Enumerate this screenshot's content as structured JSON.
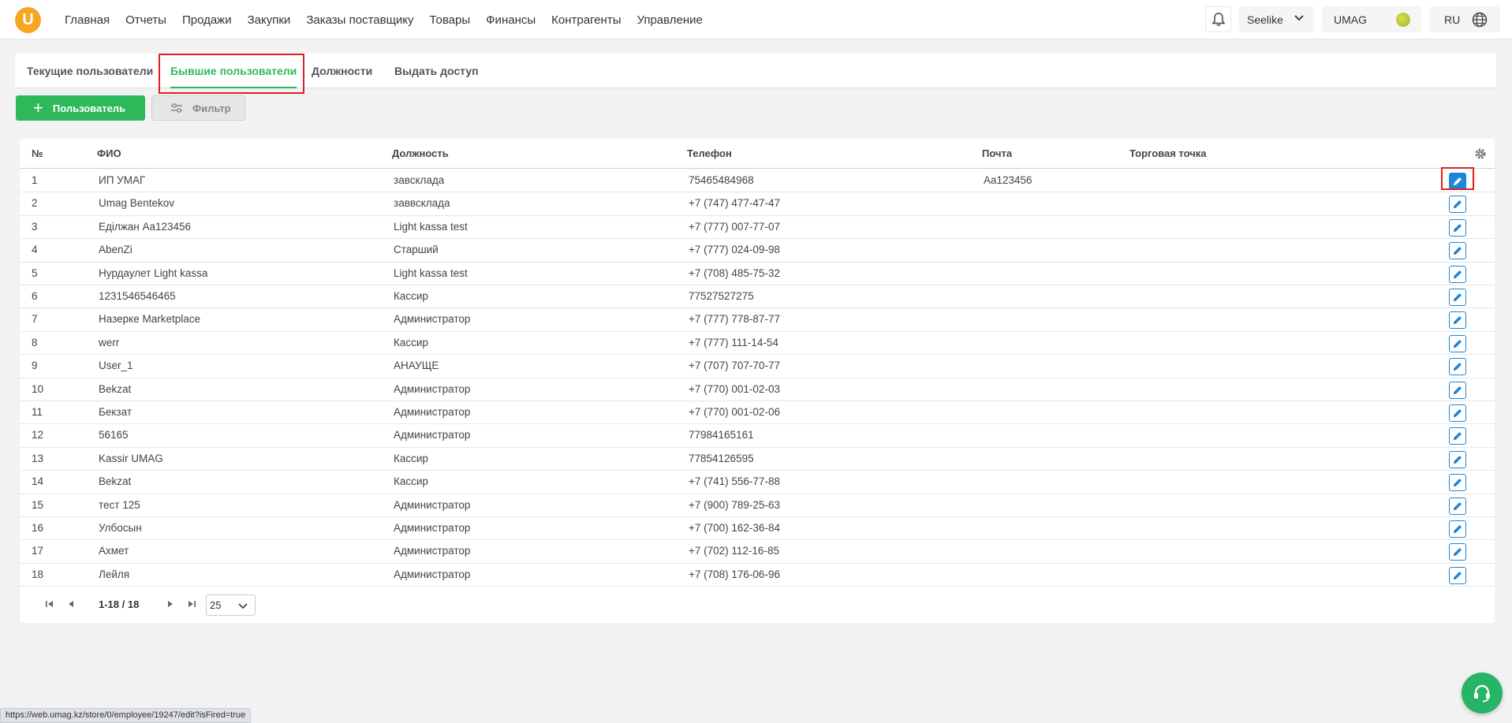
{
  "nav": {
    "logo": "U",
    "items": [
      "Главная",
      "Отчеты",
      "Продажи",
      "Закупки",
      "Заказы поставщику",
      "Товары",
      "Финансы",
      "Контрагенты",
      "Управление"
    ]
  },
  "header": {
    "store": "Seelike",
    "user": "UMAG",
    "lang": "RU"
  },
  "tabs": [
    "Текущие пользователи",
    "Бывшие пользователи",
    "Должности",
    "Выдать доступ"
  ],
  "toolbar": {
    "add_label": "Пользователь",
    "filter_label": "Фильтр"
  },
  "table": {
    "headers": [
      "№",
      "ФИО",
      "Должность",
      "Телефон",
      "Почта",
      "Торговая точка"
    ],
    "rows": [
      [
        "1",
        "ИП УМАГ",
        "завсклада",
        "75465484968",
        "Aa123456",
        ""
      ],
      [
        "2",
        "Umag Bentekov",
        "заввсклада",
        "+7 (747) 477-47-47",
        "",
        ""
      ],
      [
        "3",
        "Еділжан Aa123456",
        "Light kassa test",
        "+7 (777) 007-77-07",
        "",
        ""
      ],
      [
        "4",
        "AbenZi",
        "Старший",
        "+7 (777) 024-09-98",
        "",
        ""
      ],
      [
        "5",
        "Нурдаулет Light kassa",
        "Light kassa test",
        "+7 (708) 485-75-32",
        "",
        ""
      ],
      [
        "6",
        "1231546546465",
        "Кассир",
        "77527527275",
        "",
        ""
      ],
      [
        "7",
        "Назерке Marketplace",
        "Администратор",
        "+7 (777) 778-87-77",
        "",
        ""
      ],
      [
        "8",
        "werr",
        "Кассир",
        "+7 (777) 111-14-54",
        "",
        ""
      ],
      [
        "9",
        "User_1",
        "АНАУЩЕ",
        "+7 (707) 707-70-77",
        "",
        ""
      ],
      [
        "10",
        "Bekzat",
        "Администратор",
        "+7 (770) 001-02-03",
        "",
        ""
      ],
      [
        "11",
        "Бекзат",
        "Администратор",
        "+7 (770) 001-02-06",
        "",
        ""
      ],
      [
        "12",
        "56165",
        "Администратор",
        "77984165161",
        "",
        ""
      ],
      [
        "13",
        "Kassir UMAG",
        "Кассир",
        "77854126595",
        "",
        ""
      ],
      [
        "14",
        "Bekzat",
        "Кассир",
        "+7 (741) 556-77-88",
        "",
        ""
      ],
      [
        "15",
        "тест 125",
        "Администратор",
        "+7 (900) 789-25-63",
        "",
        ""
      ],
      [
        "16",
        "Улбосын",
        "Администратор",
        "+7 (700) 162-36-84",
        "",
        ""
      ],
      [
        "17",
        "Ахмет",
        "Администратор",
        "+7 (702) 112-16-85",
        "",
        ""
      ],
      [
        "18",
        "Лейля",
        "Администратор",
        "+7 (708) 176-06-96",
        "",
        ""
      ]
    ]
  },
  "pagination": {
    "info": "1-18 / 18",
    "page_size": "25"
  },
  "statusbar": {
    "url": "https://web.umag.kz/store/0/employee/19247/edit?isFired=true"
  },
  "colors": {
    "accent_green": "#2fb85a",
    "edit_blue": "#1b87d9",
    "highlight_red": "#e02020"
  }
}
